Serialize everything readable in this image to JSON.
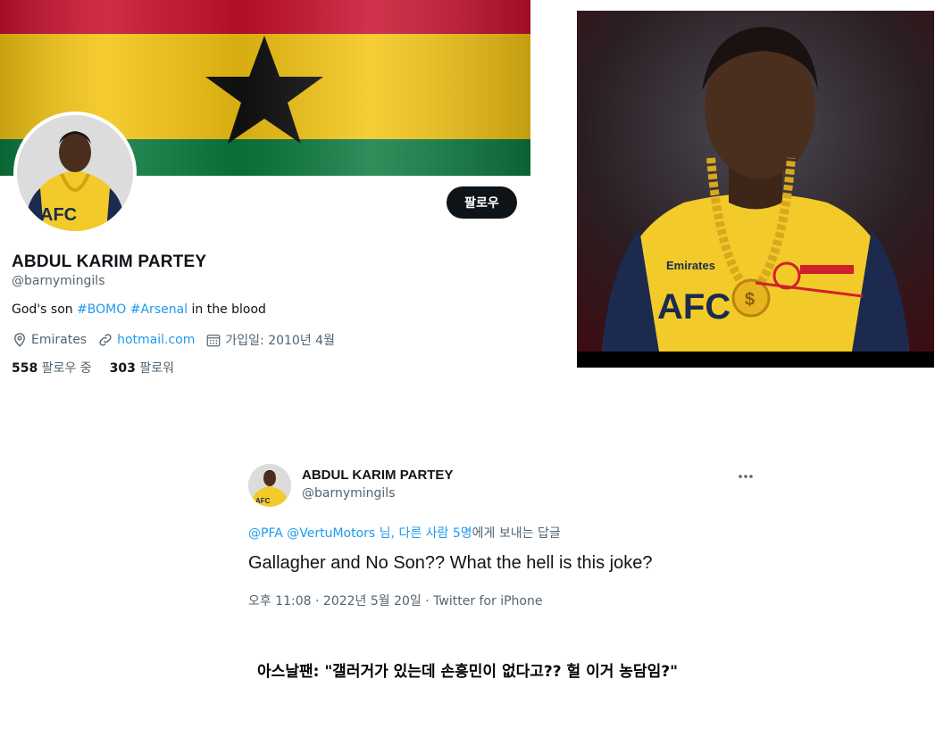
{
  "profile": {
    "follow_button": "팔로우",
    "display_name": "ABDUL KARIM PARTEY",
    "handle": "@barnymingils",
    "bio": {
      "prefix": "God's son ",
      "tag1": "#BOMO",
      "space": " ",
      "tag2": "#Arsenal",
      "suffix": " in the blood"
    },
    "location": "Emirates",
    "website": "hotmail.com",
    "joined": "가입일: 2010년 4월",
    "following_count": "558",
    "following_label": " 팔로우 중",
    "followers_count": "303",
    "followers_label": " 팔로워"
  },
  "tweet": {
    "display_name": "ABDUL KARIM PARTEY",
    "handle": "@barnymingils",
    "reply_mentions": "@PFA @VertuMotors",
    "reply_others": " 님, 다른 사람 5명",
    "reply_suffix": "에게 보내는 답글",
    "text": "Gallagher and No Son?? What the hell is this joke?",
    "meta": "오후 11:08 · 2022년 5월 20일 · Twitter for iPhone"
  },
  "caption": "아스날팬: \"갤러거가 있는데 손흥민이 없다고?? 헐 이거 농담임?\"",
  "colors": {
    "accent": "#1d9bf0",
    "secondary_text": "#536471",
    "primary_text": "#0f1419",
    "flag_red": "#c8102e",
    "flag_yellow": "#fcd116",
    "flag_green": "#006b3f",
    "jersey_yellow": "#f2cb2a",
    "jersey_navy": "#1b2a4e"
  },
  "icons": [
    "location-icon",
    "link-icon",
    "calendar-icon",
    "more-icon",
    "flag-star-icon"
  ]
}
